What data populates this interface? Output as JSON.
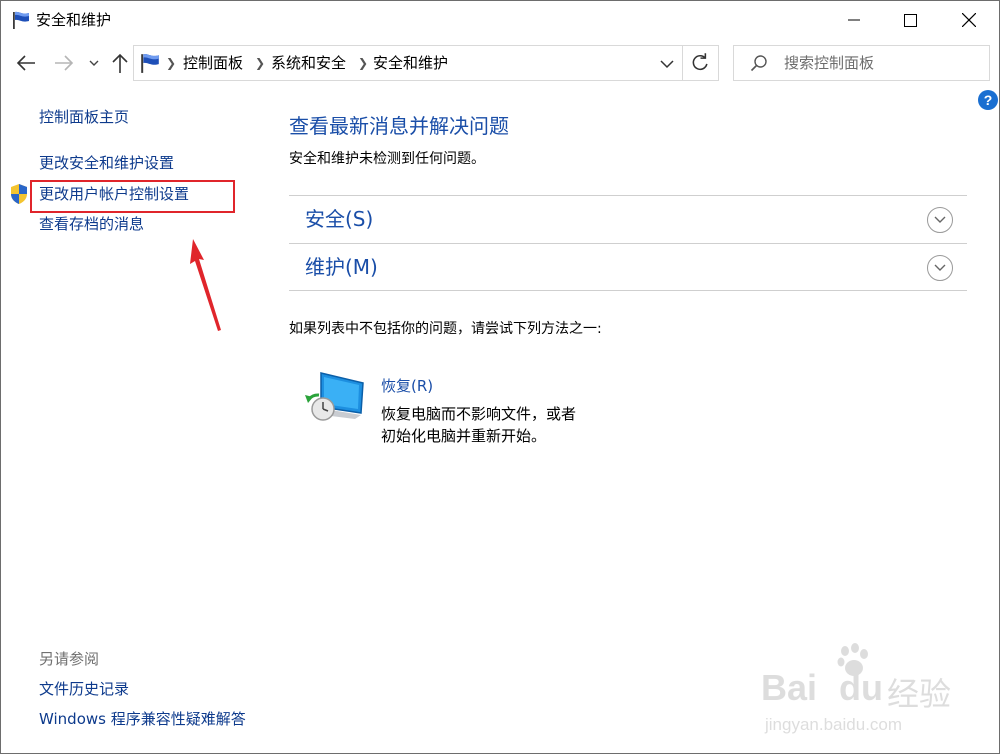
{
  "window": {
    "title": "安全和维护",
    "controls": {
      "minimize": "minimize",
      "maximize": "maximize",
      "close": "close"
    }
  },
  "navigation": {
    "breadcrumbs": [
      "控制面板",
      "系统和安全",
      "安全和维护"
    ],
    "search_placeholder": "搜索控制面板"
  },
  "sidebar": {
    "links": [
      {
        "label": "控制面板主页"
      },
      {
        "label": "更改安全和维护设置"
      },
      {
        "label": "更改用户帐户控制设置",
        "icon": "uac-shield-icon",
        "highlighted": true
      },
      {
        "label": "查看存档的消息"
      }
    ],
    "see_also_heading": "另请参阅",
    "see_also_links": [
      {
        "label": "文件历史记录"
      },
      {
        "label": "Windows 程序兼容性疑难解答"
      }
    ]
  },
  "main": {
    "title": "查看最新消息并解决问题",
    "description": "安全和维护未检测到任何问题。",
    "sections": [
      {
        "label": "安全(S)",
        "icon": "chevron-down-icon"
      },
      {
        "label": "维护(M)",
        "icon": "chevron-down-icon"
      }
    ],
    "try_text": "如果列表中不包括你的问题，请尝试下列方法之一:",
    "recovery": {
      "label": "恢复(R)",
      "description_lines": [
        "恢复电脑而不影响文件，或者",
        "初始化电脑并重新开始。"
      ]
    }
  },
  "watermark": {
    "brand": "Bai",
    "brand_suffix": "du",
    "chinese": "经验",
    "url": "jingyan.baidu.com"
  },
  "colors": {
    "link_blue": "#0d3a8c",
    "heading_blue": "#1a4ea8",
    "highlight_red": "#e0252b",
    "help_blue": "#1a6fd1"
  }
}
